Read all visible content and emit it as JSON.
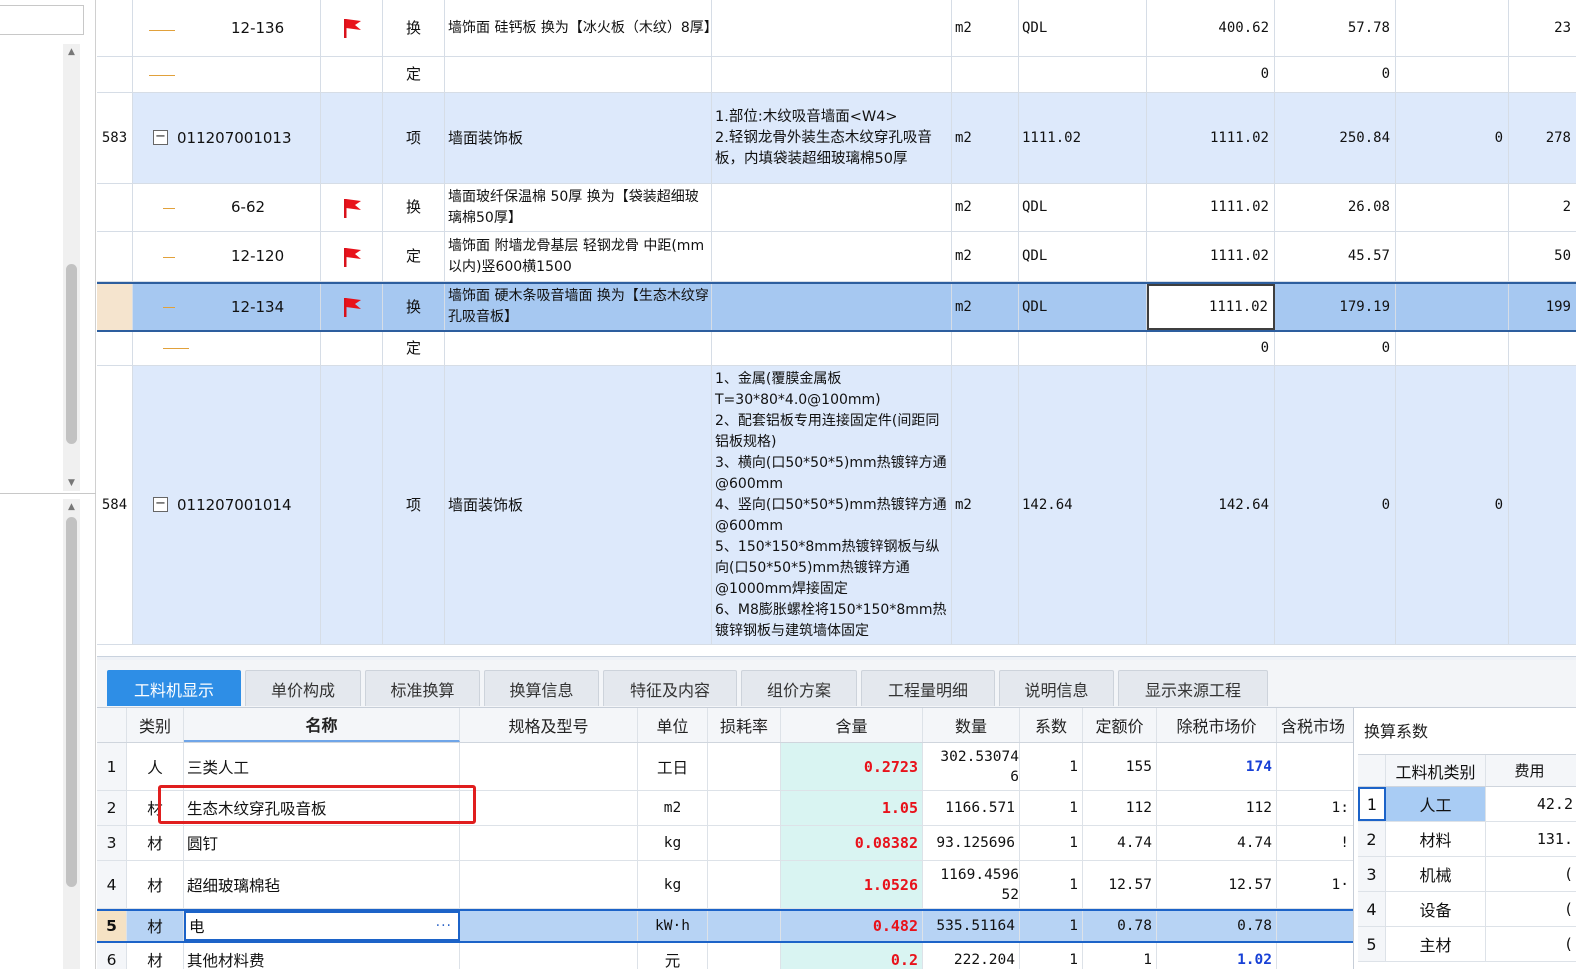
{
  "upper_grid": {
    "rows": [
      {
        "num": "",
        "code": "12-136",
        "flag": true,
        "type": "换",
        "name": "墙饰面 硅钙板  换为【冰火板（木纹）8厚】",
        "desc": "",
        "unit": "m2",
        "expr": "QDL",
        "qty": "400.62",
        "price": "57.78",
        "z": "",
        "last": "23"
      },
      {
        "num": "",
        "code": "",
        "flag": false,
        "type": "定",
        "name": "",
        "desc": "",
        "unit": "",
        "expr": "",
        "qty": "0",
        "price": "0",
        "z": "",
        "last": ""
      },
      {
        "num": "583",
        "code": "011207001013",
        "flag": false,
        "type": "项",
        "name": "墙面装饰板",
        "desc": "1.部位:木纹吸音墙面<W4>\n2.轻钢龙骨外装生态木纹穿孔吸音板，内填袋装超细玻璃棉50厚",
        "unit": "m2",
        "expr": "1111.02",
        "qty": "1111.02",
        "price": "250.84",
        "z": "0",
        "last": "278"
      },
      {
        "num": "",
        "code": "6-62",
        "flag": true,
        "type": "换",
        "name": "墙面玻纤保温棉 50厚  换为【袋装超细玻璃棉50厚】",
        "desc": "",
        "unit": "m2",
        "expr": "QDL",
        "qty": "1111.02",
        "price": "26.08",
        "z": "",
        "last": "2"
      },
      {
        "num": "",
        "code": "12-120",
        "flag": true,
        "type": "定",
        "name": "墙饰面 附墙龙骨基层 轻钢龙骨 中距(mm以内)竖600横1500",
        "desc": "",
        "unit": "m2",
        "expr": "QDL",
        "qty": "1111.02",
        "price": "45.57",
        "z": "",
        "last": "50"
      },
      {
        "num": "",
        "code": "12-134",
        "flag": true,
        "type": "换",
        "name": "墙饰面 硬木条吸音墙面  换为【生态木纹穿孔吸音板】",
        "desc": "",
        "unit": "m2",
        "expr": "QDL",
        "qty": "1111.02",
        "price": "179.19",
        "z": "",
        "last": "199"
      },
      {
        "num": "",
        "code": "",
        "flag": false,
        "type": "定",
        "name": "",
        "desc": "",
        "unit": "",
        "expr": "",
        "qty": "0",
        "price": "0",
        "z": "",
        "last": ""
      },
      {
        "num": "584",
        "code": "011207001014",
        "flag": false,
        "type": "项",
        "name": "墙面装饰板",
        "desc": "1、金属(覆膜金属板T=30*80*4.0@100mm)\n2、配套铝板专用连接固定件(间距同铝板规格)\n3、横向(口50*50*5)mm热镀锌方通@600mm\n4、竖向(口50*50*5)mm热镀锌方通@600mm\n5、150*150*8mm热镀锌钢板与纵向(口50*50*5)mm热镀锌方通@1000mm焊接固定\n6、M8膨胀螺栓将150*150*8mm热镀锌钢板与建筑墙体固定",
        "unit": "m2",
        "expr": "142.64",
        "qty": "142.64",
        "price": "0",
        "z": "0",
        "last": ""
      }
    ]
  },
  "tabs": [
    "工料机显示",
    "单价构成",
    "标准换算",
    "换算信息",
    "特征及内容",
    "组价方案",
    "工程量明细",
    "说明信息",
    "显示来源工程"
  ],
  "material_grid": {
    "headers": {
      "cat": "类别",
      "name": "名称",
      "spec": "规格及型号",
      "unit": "单位",
      "loss": "损耗率",
      "qty": "含量",
      "num": "数量",
      "coef": "系数",
      "fix": "定额价",
      "mkt": "除税市场价",
      "tax": "含税市场"
    },
    "rows": [
      {
        "idx": "1",
        "cat": "人",
        "name": "三类人工",
        "unit": "工日",
        "qty": "0.2723",
        "num1": "302.53074",
        "num2": "6",
        "coef": "1",
        "fix": "155",
        "mkt": "174",
        "mkt_blue": true,
        "tax": ""
      },
      {
        "idx": "2",
        "cat": "材",
        "name": "生态木纹穿孔吸音板",
        "unit": "m2",
        "qty": "1.05",
        "num1": "1166.571",
        "num2": "",
        "coef": "1",
        "fix": "112",
        "mkt": "112",
        "mkt_blue": false,
        "tax": "1:"
      },
      {
        "idx": "3",
        "cat": "材",
        "name": "圆钉",
        "unit": "kg",
        "qty": "0.08382",
        "num1": "93.125696",
        "num2": "",
        "coef": "1",
        "fix": "4.74",
        "mkt": "4.74",
        "mkt_blue": false,
        "tax": "!"
      },
      {
        "idx": "4",
        "cat": "材",
        "name": "超细玻璃棉毡",
        "unit": "kg",
        "qty": "1.0526",
        "num1": "1169.4596",
        "num2": "52",
        "coef": "1",
        "fix": "12.57",
        "mkt": "12.57",
        "mkt_blue": false,
        "tax": "1·"
      },
      {
        "idx": "5",
        "cat": "材",
        "name": "电",
        "unit": "kW·h",
        "qty": "0.482",
        "num1": "535.51164",
        "num2": "",
        "coef": "1",
        "fix": "0.78",
        "mkt": "0.78",
        "mkt_blue": false,
        "tax": ""
      },
      {
        "idx": "6",
        "cat": "材",
        "name": "其他材料费",
        "unit": "元",
        "qty": "0.2",
        "num1": "222.204",
        "num2": "",
        "coef": "1",
        "fix": "1",
        "mkt": "1.02",
        "mkt_blue": true,
        "tax": ""
      }
    ]
  },
  "side_panel": {
    "title": "换算系数",
    "headers": {
      "cat": "工料机类别",
      "fee": "费用"
    },
    "rows": [
      {
        "idx": "1",
        "cat": "人工",
        "fee": "42.2"
      },
      {
        "idx": "2",
        "cat": "材料",
        "fee": "131."
      },
      {
        "idx": "3",
        "cat": "机械",
        "fee": "("
      },
      {
        "idx": "4",
        "cat": "设备",
        "fee": "("
      },
      {
        "idx": "5",
        "cat": "主材",
        "fee": "("
      }
    ]
  },
  "colors": {
    "accent": "#2e8ee6",
    "highlight_box": "#e01e1e",
    "selected_row": "#a6c8f1",
    "item_row": "#dde9fb",
    "red_qty": "#e8121b",
    "blue_price": "#1740d6"
  }
}
